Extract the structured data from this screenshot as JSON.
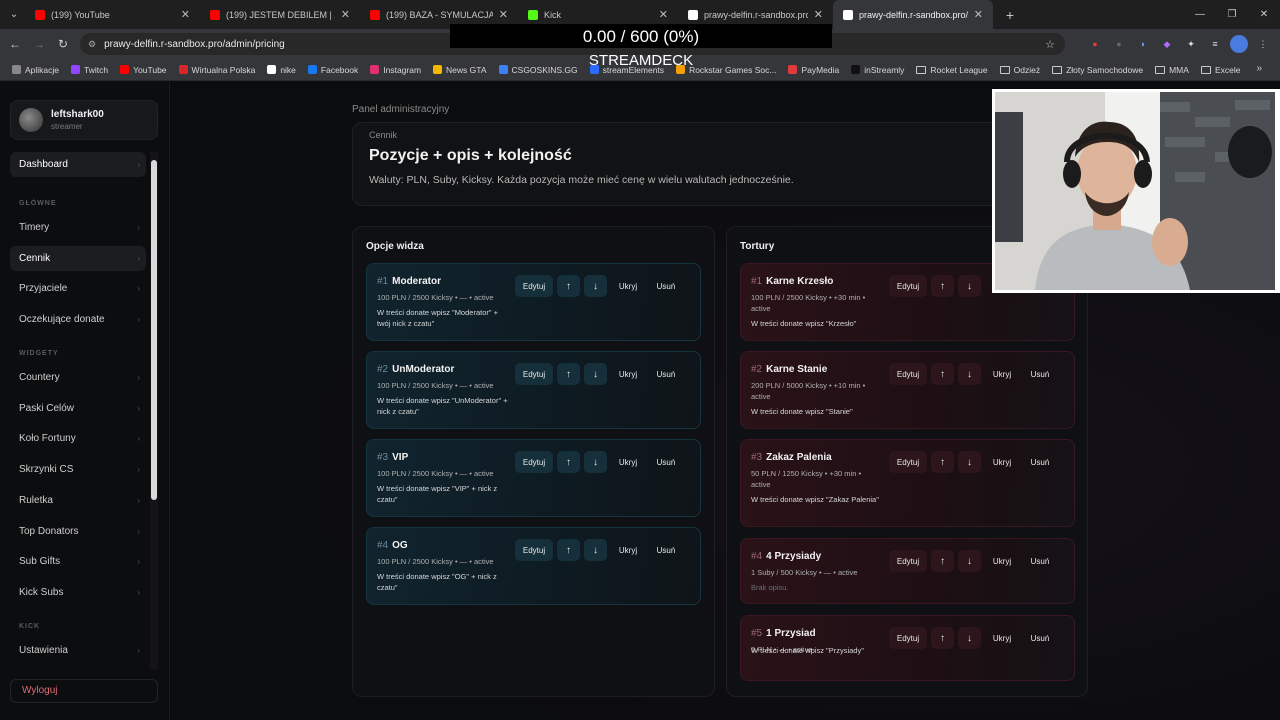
{
  "browser": {
    "tabs": [
      {
        "title": "(199) YouTube",
        "color": "#ff0000",
        "active": false
      },
      {
        "title": "(199) JESTEM DEBILEM | ZBUD(",
        "color": "#ff0000",
        "active": false
      },
      {
        "title": "(199) BAZA - SYMULACJA - Yo",
        "color": "#ff0000",
        "active": false
      },
      {
        "title": "Kick",
        "color": "#53fc18",
        "active": false
      },
      {
        "title": "prawy-delfin.r-sandbox.pro",
        "color": "#ffffff",
        "active": false
      },
      {
        "title": "prawy-delfin.r-sandbox.pro/ad",
        "color": "#ffffff",
        "active": true
      }
    ],
    "url": "prawy-delfin.r-sandbox.pro/admin/pricing",
    "bookmarks": [
      {
        "label": "Aplikacje",
        "color": "#888888",
        "folder": false
      },
      {
        "label": "Twitch",
        "color": "#9146ff",
        "folder": false
      },
      {
        "label": "YouTube",
        "color": "#ff0000",
        "folder": false
      },
      {
        "label": "Wirtualna Polska",
        "color": "#d8262c",
        "folder": false
      },
      {
        "label": "nike",
        "color": "#ffffff",
        "folder": false
      },
      {
        "label": "Facebook",
        "color": "#1877f2",
        "folder": false
      },
      {
        "label": "Instagram",
        "color": "#e1306c",
        "folder": false
      },
      {
        "label": "News GTA",
        "color": "#f5b800",
        "folder": false
      },
      {
        "label": "CSGOSKINS.GG",
        "color": "#3b82f6",
        "folder": false
      },
      {
        "label": "streamElements",
        "color": "#2b6cff",
        "folder": false
      },
      {
        "label": "Rockstar Games Soc...",
        "color": "#f5a000",
        "folder": false
      },
      {
        "label": "PayMedia",
        "color": "#e03a3a",
        "folder": false
      },
      {
        "label": "inStreamly",
        "color": "#111111",
        "folder": false
      },
      {
        "label": "Rocket League",
        "color": "",
        "folder": true
      },
      {
        "label": "Odzież",
        "color": "",
        "folder": true
      },
      {
        "label": "Złoty Samochodowe",
        "color": "",
        "folder": true
      },
      {
        "label": "MMA",
        "color": "",
        "folder": true
      },
      {
        "label": "Excele",
        "color": "",
        "folder": true
      }
    ]
  },
  "overlay": {
    "progress": "0.00 / 600 (0%)",
    "label": "STREAMDECK"
  },
  "sidebar": {
    "user": {
      "name": "leftshark00",
      "role": "streamer"
    },
    "dashboard": "Dashboard",
    "section_main": "GŁÓWNE",
    "main_items": [
      "Timery",
      "Cennik",
      "Przyjaciele",
      "Oczekujące donate"
    ],
    "section_widgets": "WIDGETY",
    "widget_items": [
      "Countery",
      "Paski Celów",
      "Koło Fortuny",
      "Skrzynki CS",
      "Ruletka",
      "Top Donators",
      "Sub Gifts",
      "Kick Subs"
    ],
    "section_kick": "KICK",
    "kick_items": [
      "Ustawienia"
    ],
    "logout": "Wyloguj"
  },
  "main": {
    "panel_label": "Panel administracyjny",
    "kicker": "Cennik",
    "title": "Pozycje + opis + kolejność",
    "description": "Waluty: PLN, Suby, Kicksy. Każda pozycja może mieć cenę w wielu walutach jednocześnie.",
    "buttons": {
      "edit": "Edytuj",
      "up": "↑",
      "down": "↓",
      "hide": "Ukryj",
      "delete": "Usuń"
    },
    "left_column": {
      "title": "Opcje widza",
      "items": [
        {
          "num": "#1",
          "name": "Moderator",
          "meta": "100 PLN / 2500 Kicksy • — • active",
          "desc": "W treści donate wpisz \"Moderator\" + twój nick z czatu\""
        },
        {
          "num": "#2",
          "name": "UnModerator",
          "meta": "100 PLN / 2500 Kicksy • — • active",
          "desc": "W treści donate wpisz \"UnModerator\" + nick z czatu\""
        },
        {
          "num": "#3",
          "name": "VIP",
          "meta": "100 PLN / 2500 Kicksy • — • active",
          "desc": "W treści donate wpisz \"VIP\" + nick z czatu\""
        },
        {
          "num": "#4",
          "name": "OG",
          "meta": "100 PLN / 2500 Kicksy • — • active",
          "desc": "W treści donate wpisz \"OG\" + nick z czatu\""
        }
      ]
    },
    "right_column": {
      "title": "Tortury",
      "items": [
        {
          "num": "#1",
          "name": "Karne Krzesło",
          "meta": "100 PLN / 2500 Kicksy • +30 min • active",
          "desc": "W treści donate wpisz \"Krzesło\""
        },
        {
          "num": "#2",
          "name": "Karne Stanie",
          "meta": "200 PLN / 5000 Kicksy • +10 min • active",
          "desc": "W treści donate wpisz \"Stanie\""
        },
        {
          "num": "#3",
          "name": "Zakaz Palenia",
          "meta": "50 PLN / 1250 Kicksy • +30 min • active",
          "desc": "W treści donate wpisz \"Zakaz Palenia\""
        },
        {
          "num": "#4",
          "name": "4 Przysiady",
          "meta": "1 Suby / 500 Kicksy • — • active",
          "desc": "Brak opisu."
        },
        {
          "num": "#5",
          "name": "1 Przysiad",
          "meta": "5 PLN • — • active",
          "desc": "W treści donate wpisz \"Przysiady\""
        }
      ]
    }
  }
}
